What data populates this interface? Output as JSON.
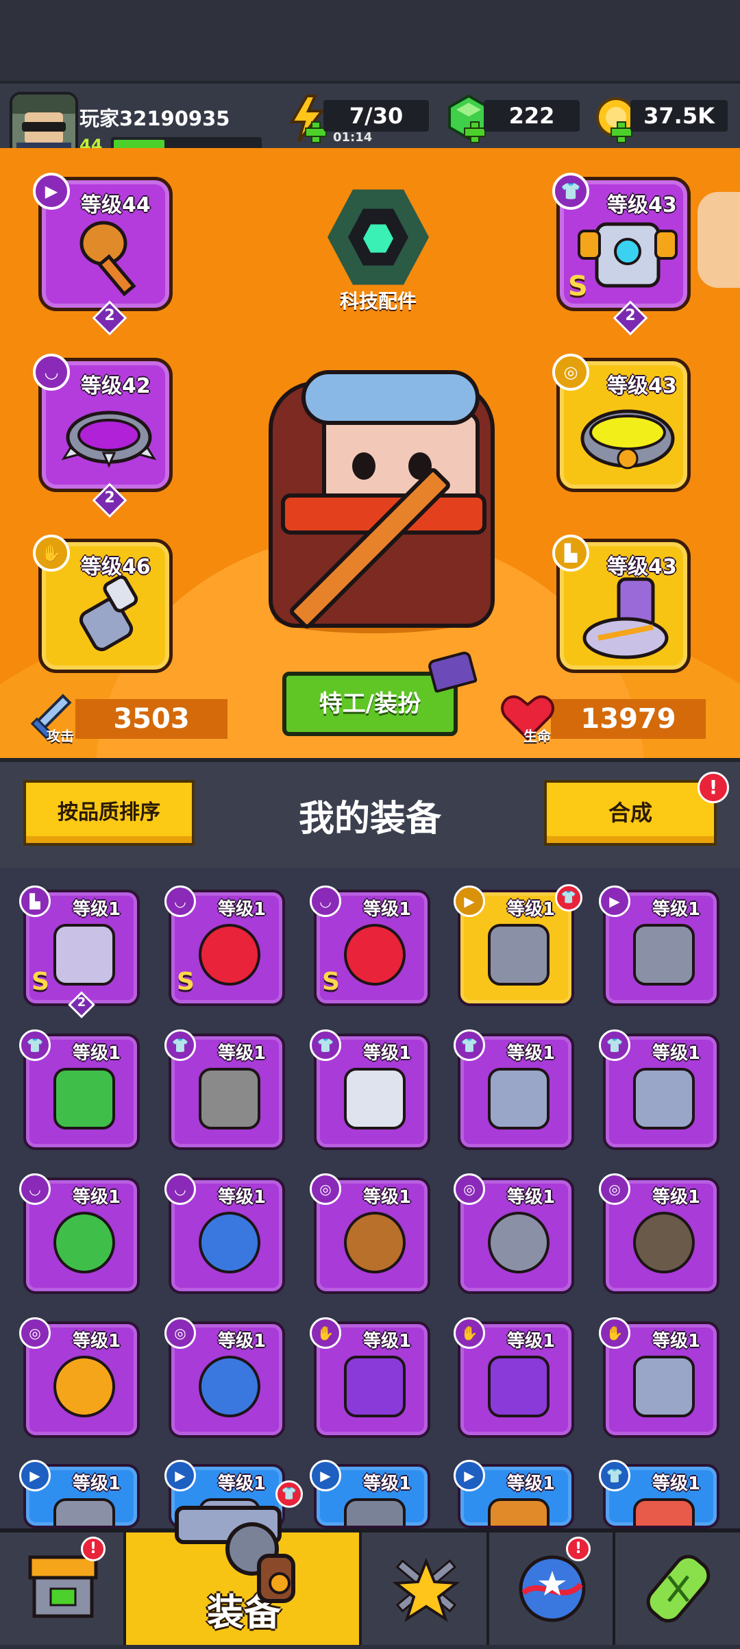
{
  "player": {
    "name": "玩家32190935",
    "level": "44",
    "xp_fraction": 0.35
  },
  "resources": {
    "energy": "7/30",
    "energy_timer": "01:14",
    "gems": "222",
    "coins": "37.5K"
  },
  "hero": {
    "tech_label": "科技配件",
    "attack_label": "攻击",
    "attack_value": "3503",
    "health_label": "生命",
    "health_value": "13979",
    "agent_button": "特工/装扮",
    "slots": {
      "weapon": {
        "level": "等级44",
        "badge_icon": "weapon-icon",
        "stars": "2"
      },
      "armor": {
        "level": "等级43",
        "badge_icon": "shirt-icon",
        "stars": "2",
        "grade": "S"
      },
      "necklace": {
        "level": "等级42",
        "badge_icon": "necklace-icon",
        "stars": "2"
      },
      "belt": {
        "level": "等级43",
        "badge_icon": "belt-icon"
      },
      "gloves": {
        "level": "等级46",
        "badge_icon": "glove-icon"
      },
      "boots": {
        "level": "等级43",
        "badge_icon": "boot-icon"
      }
    }
  },
  "equipment": {
    "sort_button": "按品质排序",
    "title": "我的装备",
    "merge_button": "合成",
    "alert": "!",
    "items": [
      {
        "level": "等级1",
        "rarity": "purple",
        "icon": "boot-icon",
        "grade": "S",
        "stars": "2",
        "item": "boots"
      },
      {
        "level": "等级1",
        "rarity": "purple",
        "icon": "necklace-icon",
        "grade": "S",
        "item": "necklace"
      },
      {
        "level": "等级1",
        "rarity": "purple",
        "icon": "necklace-icon",
        "grade": "S",
        "item": "necklace"
      },
      {
        "level": "等级1",
        "rarity": "gold",
        "icon": "weapon-icon",
        "item": "kunai",
        "alert": "shirt"
      },
      {
        "level": "等级1",
        "rarity": "purple",
        "icon": "weapon-icon",
        "item": "kunai"
      },
      {
        "level": "等级1",
        "rarity": "purple",
        "icon": "shirt-icon",
        "item": "armor-green"
      },
      {
        "level": "等级1",
        "rarity": "purple",
        "icon": "shirt-icon",
        "item": "armor-stone"
      },
      {
        "level": "等级1",
        "rarity": "purple",
        "icon": "shirt-icon",
        "item": "armor-white"
      },
      {
        "level": "等级1",
        "rarity": "purple",
        "icon": "shirt-icon",
        "item": "armor-steel"
      },
      {
        "level": "等级1",
        "rarity": "purple",
        "icon": "shirt-icon",
        "item": "armor-steel"
      },
      {
        "level": "等级1",
        "rarity": "purple",
        "icon": "necklace-icon",
        "item": "necklace-green"
      },
      {
        "level": "等级1",
        "rarity": "purple",
        "icon": "necklace-icon",
        "item": "necklace-shield"
      },
      {
        "level": "等级1",
        "rarity": "purple",
        "icon": "belt-icon",
        "item": "belt-rope"
      },
      {
        "level": "等级1",
        "rarity": "purple",
        "icon": "belt-icon",
        "item": "belt-star"
      },
      {
        "level": "等级1",
        "rarity": "purple",
        "icon": "belt-icon",
        "item": "belt-gem"
      },
      {
        "level": "等级1",
        "rarity": "purple",
        "icon": "belt-icon",
        "item": "belt-orange"
      },
      {
        "level": "等级1",
        "rarity": "purple",
        "icon": "belt-icon",
        "item": "belt-blue"
      },
      {
        "level": "等级1",
        "rarity": "purple",
        "icon": "glove-icon",
        "item": "glove-purple"
      },
      {
        "level": "等级1",
        "rarity": "purple",
        "icon": "glove-icon",
        "item": "glove-purple"
      },
      {
        "level": "等级1",
        "rarity": "purple",
        "icon": "glove-icon",
        "item": "glove-steel"
      },
      {
        "level": "等级1",
        "rarity": "blue",
        "icon": "weapon-icon",
        "item": "blade"
      },
      {
        "level": "等级1",
        "rarity": "blue",
        "icon": "weapon-icon",
        "item": "revolver"
      },
      {
        "level": "等级1",
        "rarity": "blue",
        "icon": "weapon-icon",
        "item": "gun"
      },
      {
        "level": "等级1",
        "rarity": "blue",
        "icon": "weapon-icon",
        "item": "club"
      },
      {
        "level": "等级1",
        "rarity": "blue",
        "icon": "shirt-icon",
        "item": "vest"
      }
    ]
  },
  "nav": {
    "active_label": "装备",
    "tabs": [
      {
        "name": "shop",
        "icon": "shop-icon",
        "alert": true
      },
      {
        "name": "equipment",
        "icon": "revolver-icon",
        "alert": false
      },
      {
        "name": "battle",
        "icon": "star-swords-icon",
        "alert": false
      },
      {
        "name": "world",
        "icon": "planet-icon",
        "alert": true
      },
      {
        "name": "lab",
        "icon": "dna-capsule-icon",
        "alert": false
      }
    ]
  },
  "colors": {
    "hero_bg": "#f58a0c",
    "epic": "#a93bd8",
    "legendary": "#f9c51a",
    "rare": "#2f8ff0",
    "button_yellow": "#fcc915",
    "button_green": "#5fc626"
  }
}
